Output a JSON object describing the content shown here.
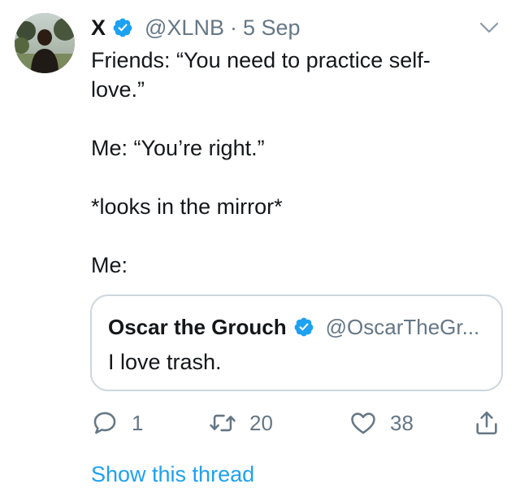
{
  "colors": {
    "text": "#14171a",
    "secondary": "#657786",
    "accent": "#1da1f2",
    "border": "#ccd6dd"
  },
  "tweet": {
    "author": {
      "display_name": "X",
      "handle": "@XLNB",
      "verified": true,
      "avatar_icon": "profile-photo"
    },
    "separator": "·",
    "timestamp": "5 Sep",
    "menu_icon": "chevron-down-icon",
    "text_lines": [
      "Friends: “You need to practice self-",
      "love.”",
      "",
      "Me: “You’re right.”",
      "",
      "*looks in the mirror*",
      "",
      "Me:"
    ],
    "quoted": {
      "display_name": "Oscar the Grouch",
      "handle": "@OscarTheGr...",
      "verified": true,
      "text": "I love trash."
    },
    "actions": {
      "reply_count": "1",
      "retweet_count": "20",
      "like_count": "38",
      "share_icon": "share-icon"
    },
    "show_thread": "Show this thread"
  }
}
